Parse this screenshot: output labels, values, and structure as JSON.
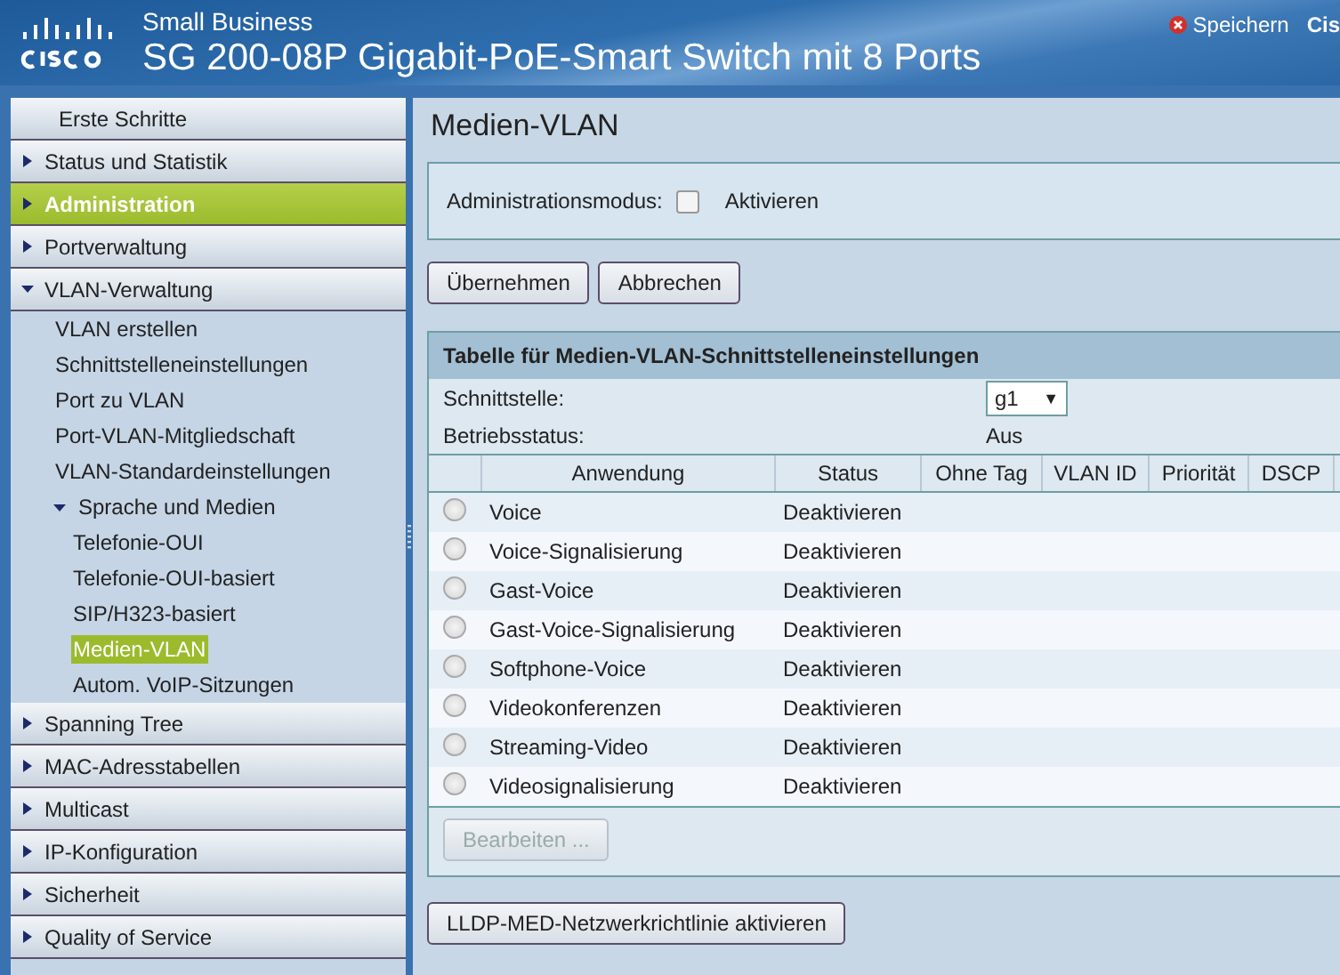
{
  "header": {
    "brand": "Small Business",
    "title": "SG 200-08P Gigabit-PoE-Smart Switch mit 8 Ports",
    "actions": [
      {
        "label": "Speichern",
        "kind": "save"
      },
      {
        "label": "Cis",
        "kind": "link"
      }
    ]
  },
  "sidebar": {
    "items": [
      {
        "label": "Erste Schritte",
        "kind": "link",
        "selected": false
      },
      {
        "label": "Status und Statistik",
        "kind": "folder",
        "expanded": false,
        "selected": false
      },
      {
        "label": "Administration",
        "kind": "folder",
        "expanded": false,
        "selected": true
      },
      {
        "label": "Portverwaltung",
        "kind": "folder",
        "expanded": false,
        "selected": false
      },
      {
        "label": "VLAN-Verwaltung",
        "kind": "folder",
        "expanded": true,
        "selected": false,
        "children": [
          {
            "label": "VLAN erstellen",
            "selected": false
          },
          {
            "label": "Schnittstelleneinstellungen",
            "selected": false
          },
          {
            "label": "Port zu VLAN",
            "selected": false
          },
          {
            "label": "Port-VLAN-Mitgliedschaft",
            "selected": false
          },
          {
            "label": "VLAN-Standardeinstellungen",
            "selected": false
          },
          {
            "label": "Sprache und Medien",
            "expanded": true,
            "selected": false,
            "children": [
              {
                "label": "Telefonie-OUI",
                "selected": false
              },
              {
                "label": "Telefonie-OUI-basiert",
                "selected": false
              },
              {
                "label": "SIP/H323-basiert",
                "selected": false
              },
              {
                "label": "Medien-VLAN",
                "selected": true
              },
              {
                "label": "Autom. VoIP-Sitzungen",
                "selected": false
              }
            ]
          }
        ]
      },
      {
        "label": "Spanning Tree",
        "kind": "folder",
        "expanded": false,
        "selected": false
      },
      {
        "label": "MAC-Adresstabellen",
        "kind": "folder",
        "expanded": false,
        "selected": false
      },
      {
        "label": "Multicast",
        "kind": "folder",
        "expanded": false,
        "selected": false
      },
      {
        "label": "IP-Konfiguration",
        "kind": "folder",
        "expanded": false,
        "selected": false
      },
      {
        "label": "Sicherheit",
        "kind": "folder",
        "expanded": false,
        "selected": false
      },
      {
        "label": "Quality of Service",
        "kind": "folder",
        "expanded": false,
        "selected": false
      }
    ]
  },
  "page": {
    "title": "Medien-VLAN",
    "admin_mode": {
      "label": "Administrationsmodus:",
      "option": "Aktivieren",
      "checked": false
    },
    "buttons": [
      {
        "label": "Übernehmen",
        "disabled": false
      },
      {
        "label": "Abbrechen",
        "disabled": false
      }
    ],
    "table": {
      "title": "Tabelle für Medien-VLAN-Schnittstelleneinstellungen",
      "interface": {
        "label": "Schnittstelle:",
        "value": "g1",
        "caret": "▼"
      },
      "oper_status": {
        "label": "Betriebsstatus:",
        "value": "Aus"
      },
      "columns": [
        "Anwendung",
        "Status",
        "Ohne Tag",
        "VLAN ID",
        "Priorität",
        "DSCP"
      ],
      "rows": [
        {
          "application": "Voice",
          "status": "Deaktivieren",
          "selected": false
        },
        {
          "application": "Voice-Signalisierung",
          "status": "Deaktivieren",
          "selected": false
        },
        {
          "application": "Gast-Voice",
          "status": "Deaktivieren",
          "selected": false
        },
        {
          "application": "Gast-Voice-Signalisierung",
          "status": "Deaktivieren",
          "selected": false
        },
        {
          "application": "Softphone-Voice",
          "status": "Deaktivieren",
          "selected": false
        },
        {
          "application": "Videokonferenzen",
          "status": "Deaktivieren",
          "selected": false
        },
        {
          "application": "Streaming-Video",
          "status": "Deaktivieren",
          "selected": false
        },
        {
          "application": "Videosignalisierung",
          "status": "Deaktivieren",
          "selected": false
        }
      ],
      "edit_button": {
        "label": "Bearbeiten ...",
        "disabled": true
      }
    },
    "footer_button": {
      "label": "LLDP-MED-Netzwerkrichtlinie aktivieren",
      "disabled": false
    }
  }
}
